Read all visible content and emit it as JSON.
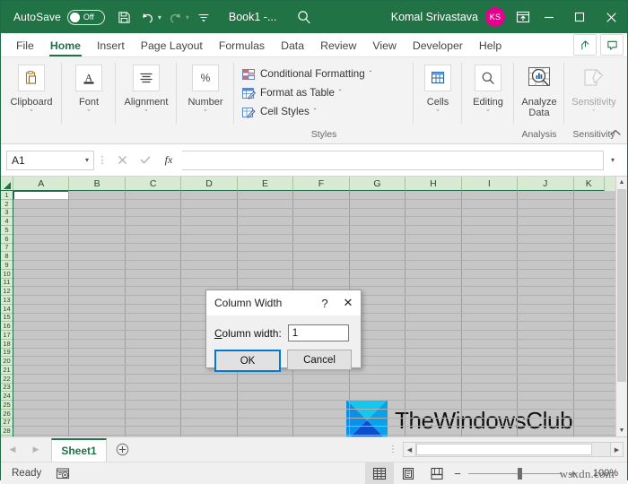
{
  "titlebar": {
    "autosave_label": "AutoSave",
    "autosave_state": "Off",
    "save_icon": "save-icon",
    "undo_icon": "undo-icon",
    "redo_icon": "redo-icon",
    "customize_icon": "customize-quick-access-icon",
    "document_title": "Book1 -...",
    "search_icon": "search-icon",
    "user_name": "Komal Srivastava",
    "user_initials": "KS",
    "ribbon_display_icon": "ribbon-display-options-icon",
    "minimize": "minimize-icon",
    "maximize": "maximize-icon",
    "close": "close-icon",
    "accent_green": "#217346",
    "avatar_color": "#e3008c"
  },
  "ribbon_tabs": [
    {
      "label": "File",
      "active": false
    },
    {
      "label": "Home",
      "active": true
    },
    {
      "label": "Insert",
      "active": false
    },
    {
      "label": "Page Layout",
      "active": false
    },
    {
      "label": "Formulas",
      "active": false
    },
    {
      "label": "Data",
      "active": false
    },
    {
      "label": "Review",
      "active": false
    },
    {
      "label": "View",
      "active": false
    },
    {
      "label": "Developer",
      "active": false
    },
    {
      "label": "Help",
      "active": false
    }
  ],
  "tabstrip_icons": [
    {
      "name": "share-icon"
    },
    {
      "name": "comments-icon"
    }
  ],
  "ribbon": {
    "groups": [
      {
        "label": "Clipboard",
        "icon": "clipboard-icon",
        "caret": "ˇ",
        "width": 68
      },
      {
        "label": "Font",
        "icon": "font-a-icon",
        "caret": "ˇ",
        "width": 60
      },
      {
        "label": "Alignment",
        "icon": "alignment-icon",
        "caret": "ˇ",
        "width": 68
      },
      {
        "label": "Number",
        "icon": "percent-icon",
        "caret": "ˇ",
        "width": 64
      }
    ],
    "styles": {
      "group_label": "Styles",
      "items": [
        {
          "label": "Conditional Formatting",
          "icon": "conditional-formatting-icon",
          "caret": "ˇ"
        },
        {
          "label": "Format as Table",
          "icon": "format-as-table-icon",
          "caret": "ˇ"
        },
        {
          "label": "Cell Styles",
          "icon": "cell-styles-icon",
          "caret": "ˇ"
        }
      ]
    },
    "right_groups": [
      {
        "label": "Cells",
        "icon": "cells-icon",
        "caret": "ˇ",
        "width": 54,
        "group_label": ""
      },
      {
        "label": "Editing",
        "icon": "editing-find-icon",
        "caret": "ˇ",
        "width": 58,
        "group_label": ""
      },
      {
        "label": "Analyze Data",
        "icon": "analyze-data-icon",
        "caret": "",
        "width": 56,
        "group_label": "Analysis"
      },
      {
        "label": "Sensitivity",
        "icon": "sensitivity-icon",
        "caret": "ˇ",
        "width": 66,
        "group_label": "Sensitivity"
      }
    ],
    "collapse_icon": "collapse-ribbon-icon"
  },
  "formula_bar": {
    "name_box_value": "A1",
    "name_box_caret": "▾",
    "cancel_icon": "cancel-x-icon",
    "enter_icon": "confirm-check-icon",
    "fx_icon": "insert-function-icon",
    "fx_label": "fx",
    "formula_value": "",
    "expand_caret": "▾"
  },
  "sheet": {
    "columns": [
      "A",
      "B",
      "C",
      "D",
      "E",
      "F",
      "G",
      "H",
      "I",
      "J",
      "K"
    ],
    "rows": [
      1,
      2,
      3,
      4,
      5,
      6,
      7,
      8,
      9,
      10,
      11,
      12,
      13,
      14,
      15,
      16,
      17,
      18,
      19,
      20,
      21,
      22,
      23,
      24,
      25,
      26,
      27,
      28
    ],
    "selected_cell": "A1",
    "select_all_icon": "select-all-corner-icon",
    "scroll_up_icon": "scroll-up-arrow-icon",
    "scroll_down_icon": "scroll-down-arrow-icon",
    "watermark_logo_text": "TheWindowsClub"
  },
  "dialog": {
    "title": "Column Width",
    "help_icon": "help-question-icon",
    "close_icon": "dialog-close-icon",
    "field_label_prefix": "C",
    "field_label_rest": "olumn width:",
    "field_value": "1",
    "ok_label": "OK",
    "cancel_label": "Cancel"
  },
  "sheet_tabs": {
    "prev_icon": "previous-sheet-arrow-icon",
    "next_icon": "next-sheet-arrow-icon",
    "tabs": [
      {
        "label": "Sheet1",
        "active": true
      }
    ],
    "add_sheet_icon": "add-sheet-plus-icon",
    "overflow_icon": "sheet-tab-overflow-icon",
    "hscroll_left_icon": "hscroll-left-arrow-icon",
    "hscroll_right_icon": "hscroll-right-arrow-icon"
  },
  "status_bar": {
    "status_text": "Ready",
    "accessibility_icon": "accessibility-checker-icon",
    "view_buttons": [
      {
        "name": "normal-view-icon",
        "active": true
      },
      {
        "name": "page-layout-view-icon",
        "active": false
      },
      {
        "name": "page-break-view-icon",
        "active": false
      }
    ],
    "zoom_out_icon": "zoom-out-minus-icon",
    "zoom_in_icon": "zoom-in-plus-icon",
    "zoom_percent": "100%",
    "watermark": "wsxdn.com"
  }
}
